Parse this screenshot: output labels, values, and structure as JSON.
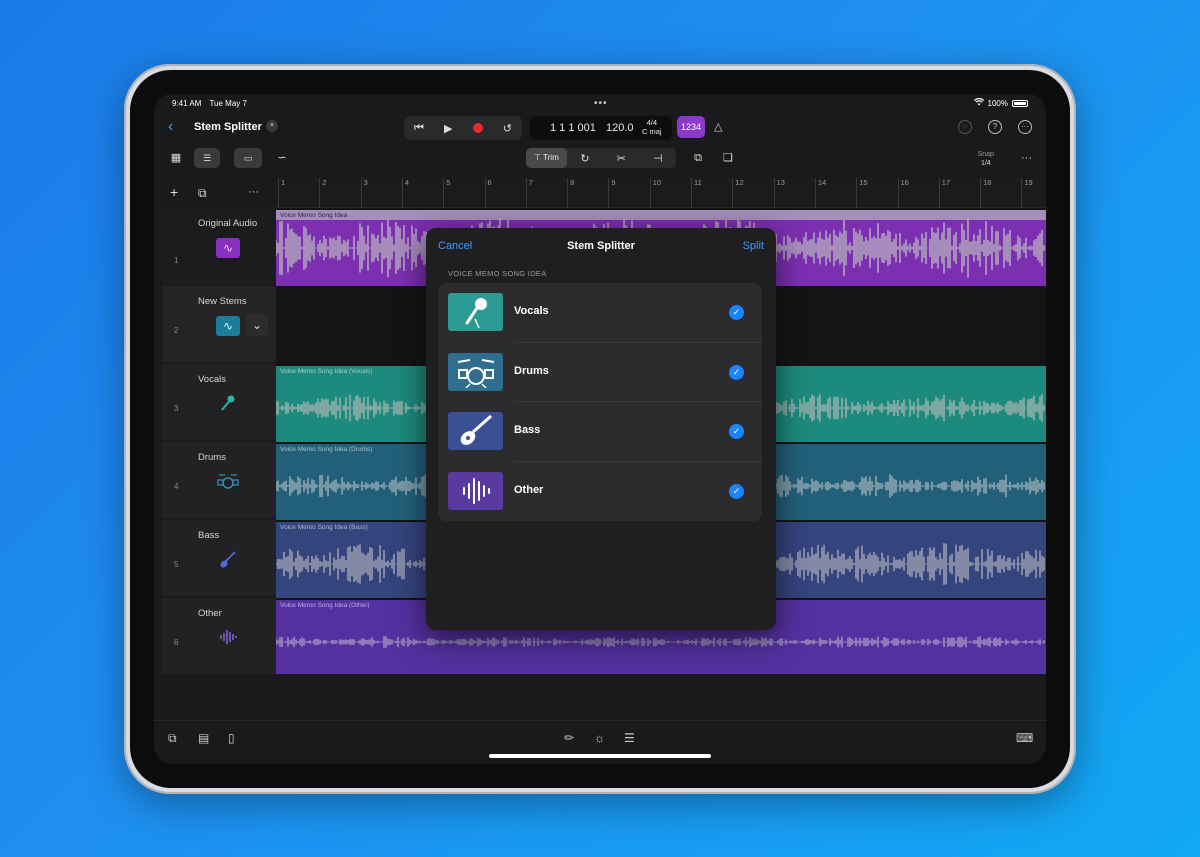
{
  "status": {
    "time": "9:41 AM",
    "date": "Tue May 7",
    "dots": "•••",
    "battery": "100%"
  },
  "toolbar": {
    "title": "Stem Splitter",
    "position": "1 1 1 001",
    "tempo": "120.0",
    "signature": "4/4",
    "key": "C maj",
    "count_in": "1234"
  },
  "toolbar2": {
    "trim_label": "Trim",
    "snap_label": "Snap",
    "snap_value": "1/4"
  },
  "ruler": [
    "1",
    "2",
    "3",
    "4",
    "5",
    "6",
    "7",
    "8",
    "9",
    "10",
    "11",
    "12",
    "13",
    "14",
    "15",
    "16",
    "17",
    "18",
    "19"
  ],
  "tracks": [
    {
      "num": "1",
      "name": "Original Audio"
    },
    {
      "num": "2",
      "name": "New Stems"
    },
    {
      "num": "3",
      "name": "Vocals"
    },
    {
      "num": "4",
      "name": "Drums"
    },
    {
      "num": "5",
      "name": "Bass"
    },
    {
      "num": "6",
      "name": "Other"
    }
  ],
  "regions": {
    "original": "Voice Memo Song Idea",
    "vocals": "Voice Memo Song Idea (Vocals)",
    "drums": "Voice Memo Song Idea (Drums)",
    "bass": "Voice Memo Song Idea (Bass)",
    "other": "Voice Memo Song Idea (Other)"
  },
  "dialog": {
    "cancel": "Cancel",
    "title": "Stem Splitter",
    "split": "Split",
    "section": "VOICE MEMO SONG IDEA",
    "stems": [
      {
        "label": "Vocals",
        "color": "#2b9a92",
        "icon": "microphone-icon",
        "checked": true
      },
      {
        "label": "Drums",
        "color": "#2f6e8e",
        "icon": "drum-kit-icon",
        "checked": true
      },
      {
        "label": "Bass",
        "color": "#3b4f94",
        "icon": "bass-guitar-icon",
        "checked": true
      },
      {
        "label": "Other",
        "color": "#5a3a9e",
        "icon": "waveform-icon",
        "checked": true
      }
    ]
  },
  "colors": {
    "original": "#7c2fb0",
    "vocals": "#1c8a7c",
    "drums": "#22607a",
    "bass": "#34447d",
    "other": "#5530a0",
    "accent": "#3b9cff"
  }
}
